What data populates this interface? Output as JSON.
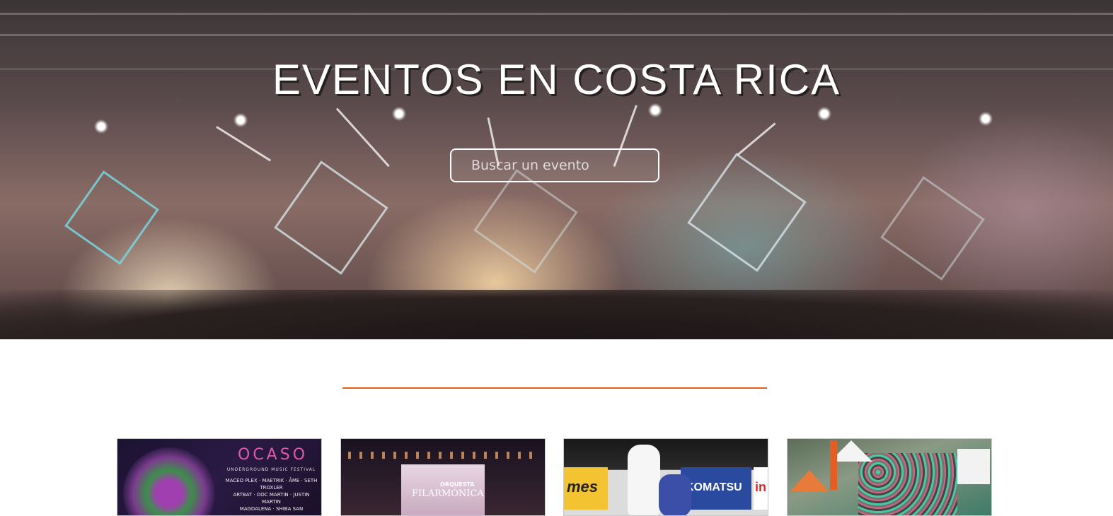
{
  "hero": {
    "title": "EVENTOS EN COSTA RICA",
    "search": {
      "placeholder": "Buscar un evento",
      "value": ""
    }
  },
  "colors": {
    "accent_divider": "#e0621c",
    "hero_text": "#ffffff",
    "page_background": "#ffffff"
  },
  "event_cards": [
    {
      "image": "festival-poster",
      "poster_logo": "OCASO",
      "poster_subtitle": "UNDERGROUND MUSIC FESTIVAL",
      "poster_lineup": "MACEO PLEX · MAETRIK · ÂME · SETH TROXLER",
      "poster_lineup_2": "ARTBAT · DOC MARTIN · JUSTIN MARTIN",
      "poster_lineup_3": "MAGDALENA · SHIBA SAN"
    },
    {
      "image": "orchestra-concert",
      "label_1": "ORQUESTA",
      "label_2": "FILARMÓNICA"
    },
    {
      "image": "judo-match",
      "sponsor_1": "mes",
      "sponsor_2": "KOMATSU",
      "sponsor_3": "in"
    },
    {
      "image": "marathon-race"
    }
  ]
}
